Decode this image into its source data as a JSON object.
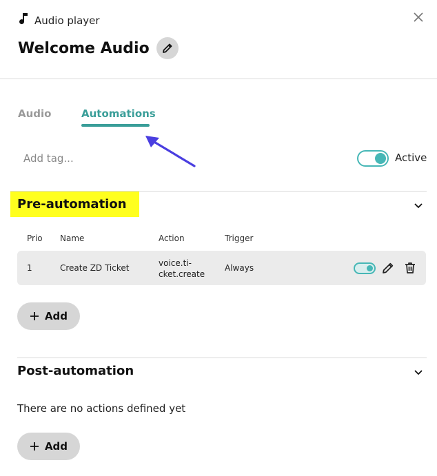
{
  "header": {
    "subtitle": "Audio player",
    "title": "Welcome Audio",
    "close_icon": "close-icon",
    "music_icon": "music-note-icon",
    "edit_icon": "pencil-icon"
  },
  "tabs": [
    {
      "label": "Audio",
      "active": false
    },
    {
      "label": "Automations",
      "active": true
    }
  ],
  "tag_input": {
    "placeholder": "Add tag...",
    "value": ""
  },
  "active_toggle": {
    "label": "Active",
    "on": true
  },
  "pre_automation": {
    "title": "Pre-automation",
    "columns": [
      "Prio",
      "Name",
      "Action",
      "Trigger"
    ],
    "rows": [
      {
        "prio": "1",
        "name": "Create ZD Ticket",
        "action_line1": "voice.ti-",
        "action_line2": "cket.create",
        "trigger": "Always",
        "enabled": true
      }
    ],
    "add_label": "Add"
  },
  "post_automation": {
    "title": "Post-automation",
    "empty_text": "There are no actions defined yet",
    "add_label": "Add"
  },
  "colors": {
    "accent": "#3a9e99",
    "toggle": "#46b7b6",
    "highlight": "#ffff1f",
    "arrow": "#4a3ee0"
  }
}
